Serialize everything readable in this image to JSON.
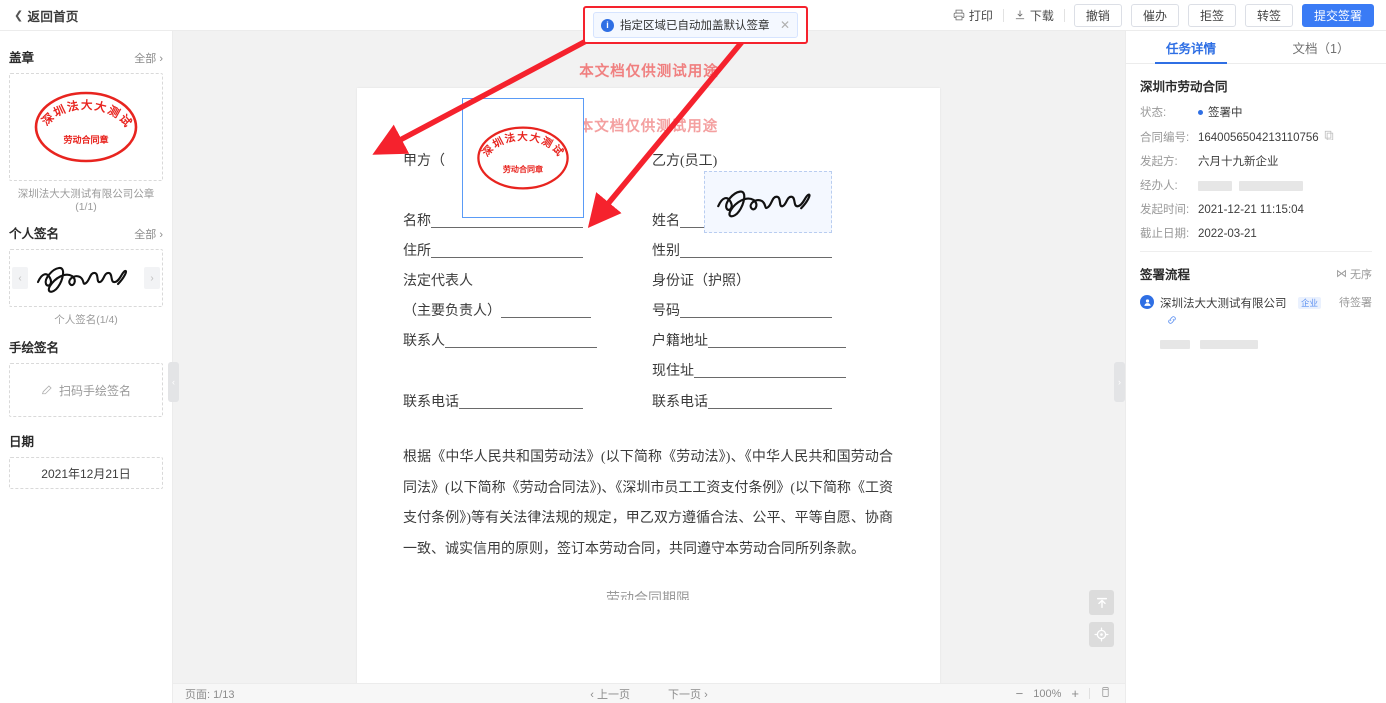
{
  "topbar": {
    "back_label": "返回首页",
    "print_label": "打印",
    "download_label": "下载",
    "buttons": [
      {
        "label": "撤销",
        "primary": false
      },
      {
        "label": "催办",
        "primary": false
      },
      {
        "label": "拒签",
        "primary": false
      },
      {
        "label": "转签",
        "primary": false
      },
      {
        "label": "提交签署",
        "primary": true
      }
    ]
  },
  "toast": {
    "message": "指定区域已自动加盖默认签章",
    "info_glyph": "i",
    "close_glyph": "✕",
    "highlight_color": "#f5222d"
  },
  "sidebar": {
    "seal": {
      "title": "盖章",
      "all_label": "全部",
      "caption": "深圳法大大测试有限公司公章(1/1)",
      "stamp_top_text": "深圳法大大测试有限公司",
      "stamp_bottom_text": "劳动合同章",
      "stamp_color": "#e8241f"
    },
    "personal_signature": {
      "title": "个人签名",
      "all_label": "全部",
      "caption": "个人签名(1/4)",
      "prev_glyph": "‹",
      "next_glyph": "›"
    },
    "handdraw": {
      "title": "手绘签名",
      "action_label": "扫码手绘签名"
    },
    "date": {
      "title": "日期",
      "value": "2021年12月21日"
    },
    "collapse_glyph": "‹"
  },
  "document": {
    "watermark": "本文档仅供测试用途",
    "left_fields": [
      "甲方（",
      "名称",
      "住所",
      "法定代表人",
      "（主要负责人）",
      "联系人",
      "联系电话"
    ],
    "right_fields": [
      "乙方(员工)",
      "姓名",
      "性别",
      "身份证（护照）",
      "号码",
      "户籍地址",
      "现住址",
      "联系电话"
    ],
    "paragraph": "根据《中华人民共和国劳动法》(以下简称《劳动法》)、《中华人民共和国劳动合同法》(以下简称《劳动合同法》)、《深圳市员工工资支付条例》(以下简称《工资支付条例》)等有关法律法规的规定，甲乙双方遵循合法、公平、平等自愿、协商一致、诚实信用的原则，签订本劳动合同，共同遵守本劳动合同所列条款。",
    "next_heading": "劳动合同期限",
    "stamp_top_text": "深圳法大大测试有限公司",
    "stamp_bottom_text": "劳动合同章",
    "float_buttons": [
      {
        "name": "scroll-to-top",
        "glyph": "⬆"
      },
      {
        "name": "locate-signature",
        "glyph": "◎"
      }
    ],
    "right_collapse_glyph": "›"
  },
  "bottombar": {
    "page_label": "页面:",
    "page_value": "1/13",
    "prev_page": "上一页",
    "next_page": "下一页",
    "prev_glyph": "‹",
    "next_glyph": "›",
    "zoom_out": "−",
    "zoom_value": "100%",
    "zoom_in": "+",
    "fit_icon": "fit-page-icon"
  },
  "right_panel": {
    "tabs": [
      {
        "label": "任务详情",
        "active": true
      },
      {
        "label": "文档（1）",
        "active": false
      }
    ],
    "doc_title": "深圳市劳动合同",
    "details": [
      {
        "label": "状态:",
        "value": "签署中",
        "type": "status"
      },
      {
        "label": "合同编号:",
        "value": "1640056504213110756",
        "type": "copy"
      },
      {
        "label": "发起方:",
        "value": "六月十九新企业",
        "type": "text"
      },
      {
        "label": "经办人:",
        "value": "",
        "type": "redacted"
      },
      {
        "label": "发起时间:",
        "value": "2021-12-21 11:15:04",
        "type": "text"
      },
      {
        "label": "截止日期:",
        "value": "2022-03-21",
        "type": "text"
      }
    ],
    "flow": {
      "title": "签署流程",
      "order_label": "无序",
      "order_glyph": "⋈",
      "participant_name": "深圳法大大测试有限公司",
      "participant_badge": "企业",
      "participant_status": "待签署"
    }
  },
  "colors": {
    "primary": "#3a7bf5",
    "accent": "#2f6fe4",
    "stamp_red": "#e8241f",
    "annotation_red": "#f5222d"
  }
}
